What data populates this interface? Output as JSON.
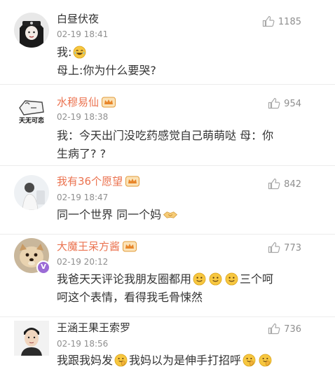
{
  "comments": [
    {
      "username": "白昼伏夜",
      "time": "02-19 18:41",
      "likes": "1185",
      "lines": [
        {
          "before": "我:",
          "emoji": "laugh-cry-emoji-icon",
          "after": ""
        },
        {
          "before": "母上:你为什么要哭?",
          "emoji": "",
          "after": ""
        }
      ]
    },
    {
      "username": "水穆易仙",
      "time": "02-19 18:38",
      "likes": "954",
      "avatar_text": "天无可恋",
      "line1": "我：今天出门没吃药感觉自己萌萌哒 母：你",
      "line2": "生病了? ?"
    },
    {
      "username": "我有36个愿望",
      "time": "02-19 18:47",
      "likes": "842",
      "line1_before": "同一个世界 同一个妈"
    },
    {
      "username": "大魔王呆方酱",
      "time": "02-19 20:12",
      "likes": "773",
      "line1_before": "我爸天天评论我朋友圈都用",
      "line1_after": "三个呵",
      "line2": "呵这个表情，看得我毛骨悚然"
    },
    {
      "username": "王涵王果王索罗",
      "time": "02-19 18:56",
      "likes": "736",
      "line1_a": "我跟我妈发",
      "line1_b": "我妈以为是伸手打招呼"
    }
  ],
  "colors": {
    "vip_name": "#eb7350",
    "meta_gray": "#8f8f8f",
    "text": "#333333"
  }
}
